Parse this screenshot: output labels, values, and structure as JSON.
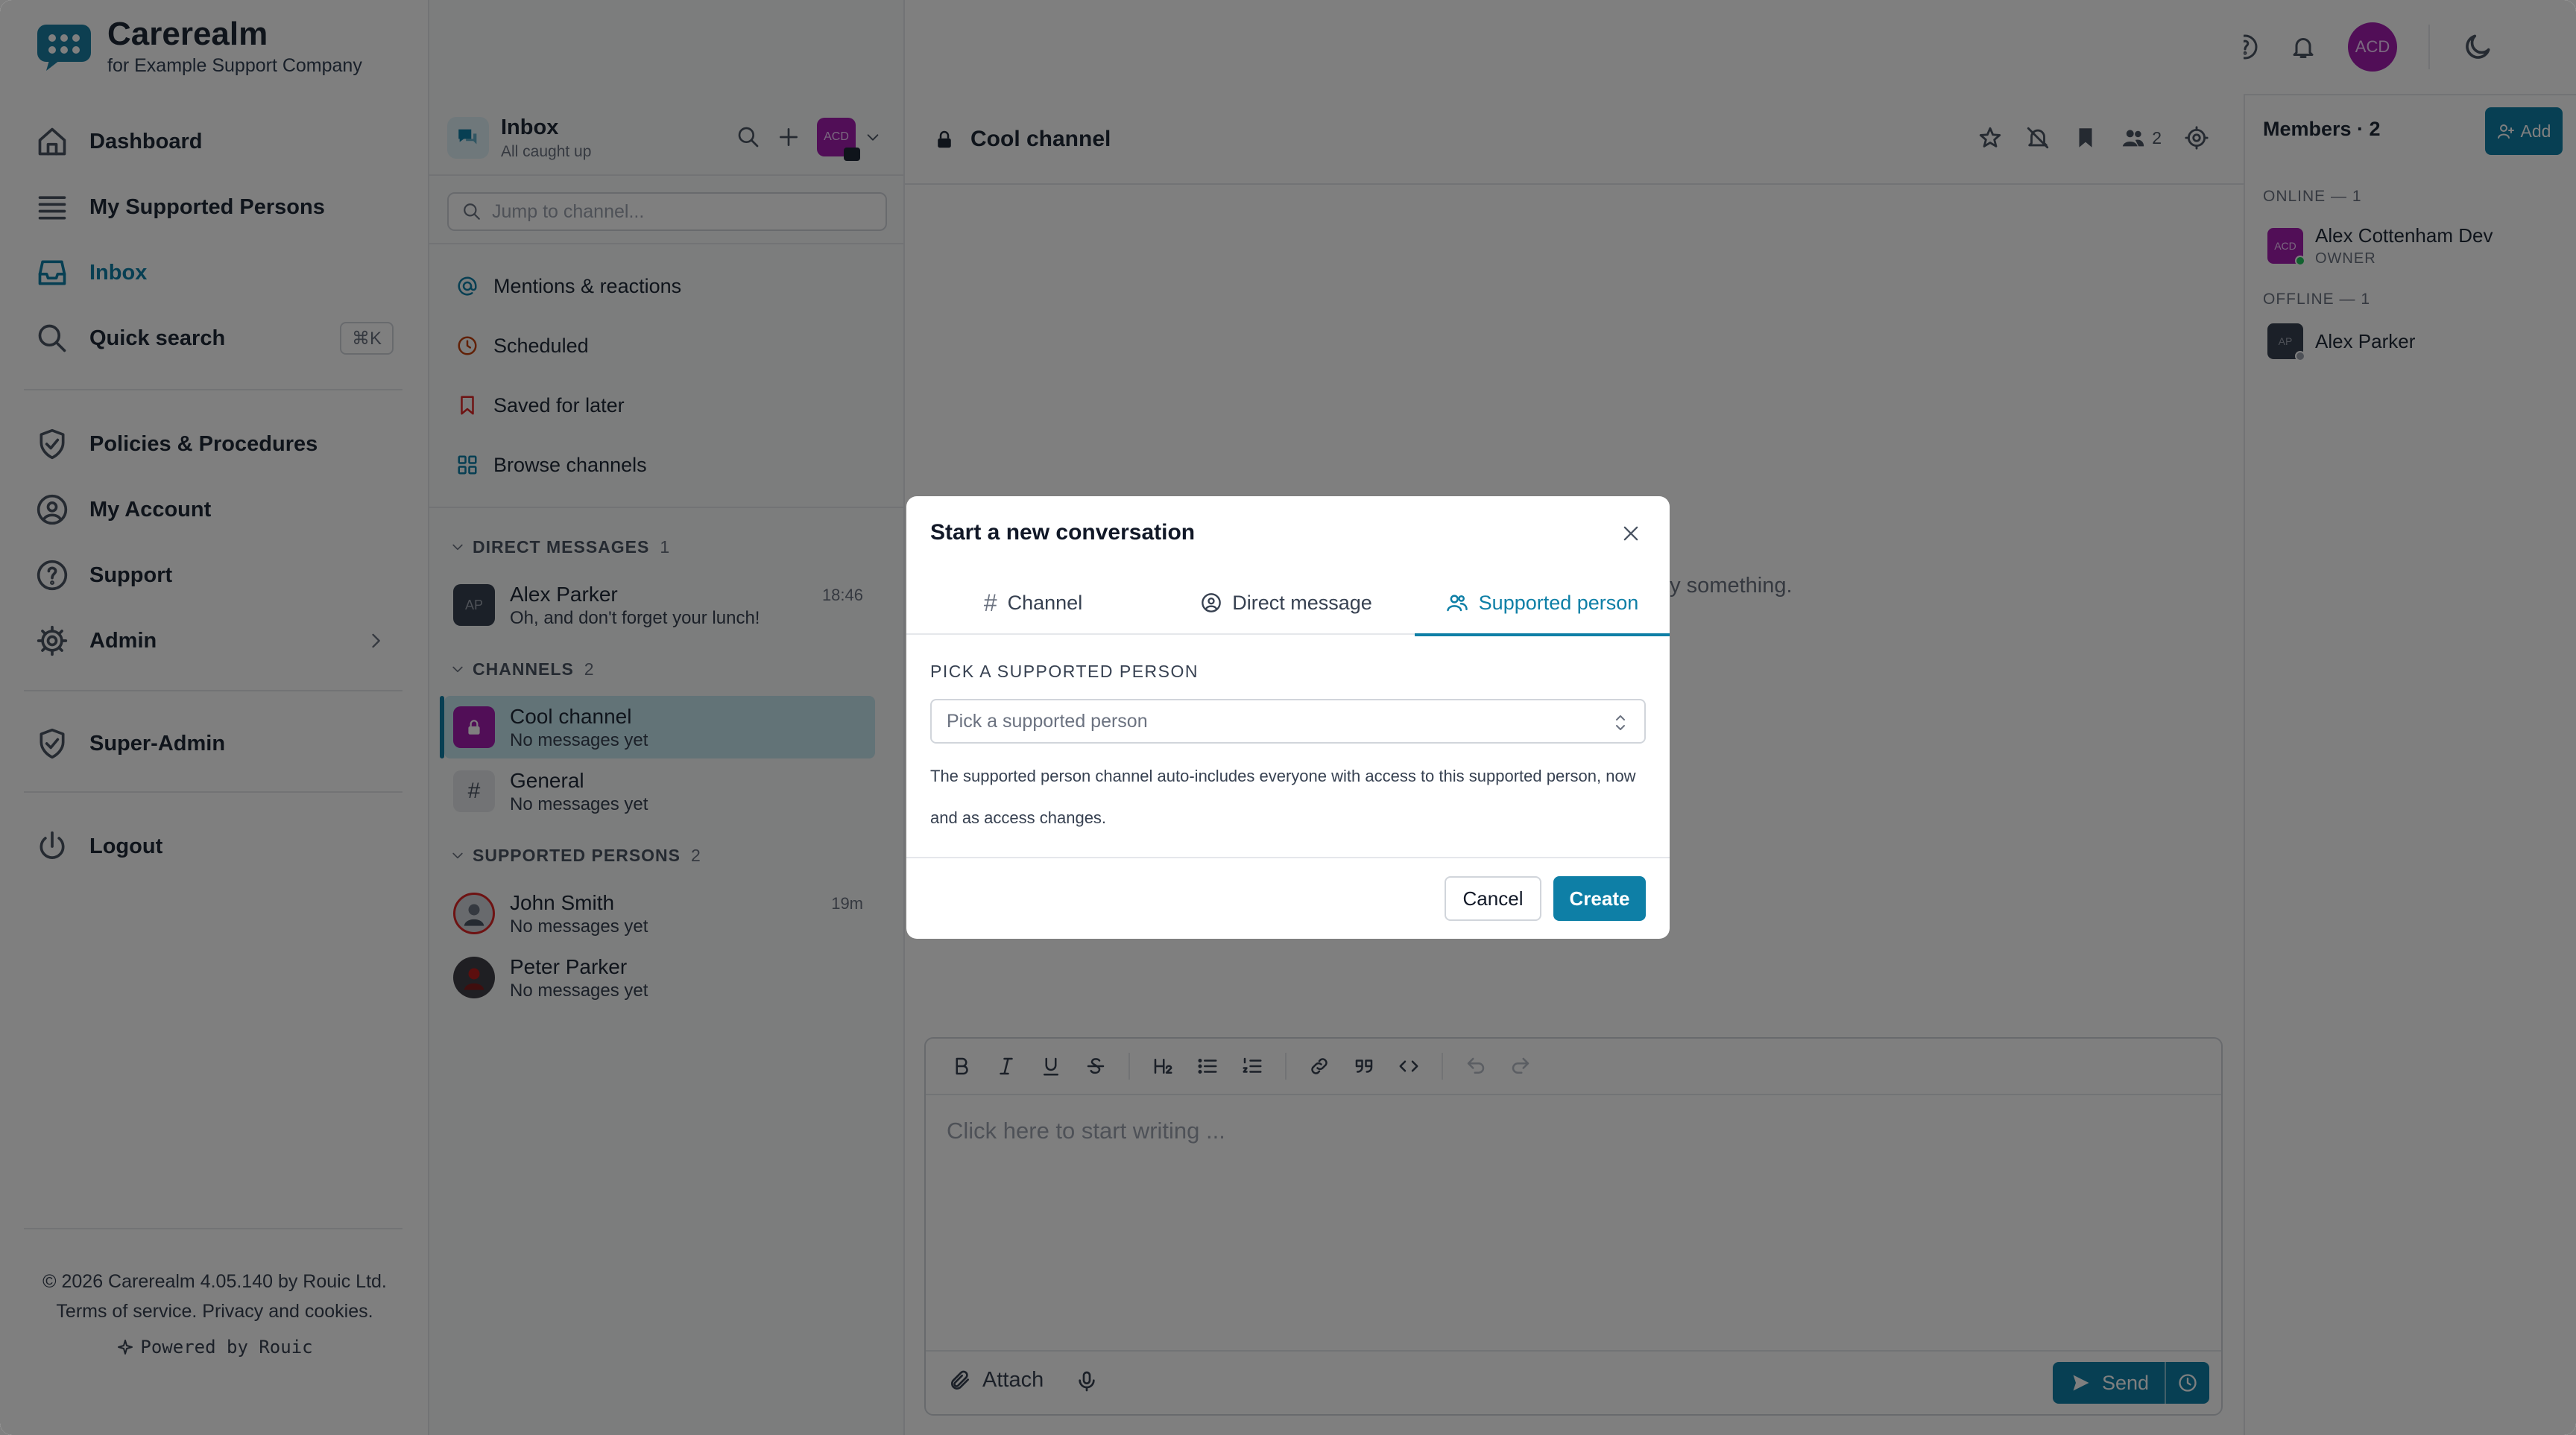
{
  "brand": {
    "name": "Carerealm",
    "sub": "for Example Support Company"
  },
  "nav": {
    "dashboard": "Dashboard",
    "supported_persons": "My Supported Persons",
    "inbox": "Inbox",
    "quick_search": "Quick search",
    "quick_search_kbd": "⌘K",
    "policies": "Policies & Procedures",
    "account": "My Account",
    "support": "Support",
    "admin": "Admin",
    "super_admin": "Super-Admin",
    "logout": "Logout"
  },
  "footer": {
    "line1": "© 2026 Carerealm 4.05.140 by Rouic Ltd.",
    "line2": "Terms of service. Privacy and cookies.",
    "powered": "Powered by Rouic"
  },
  "inbox": {
    "title": "Inbox",
    "status": "All caught up",
    "avatar_initials": "ACD",
    "jump_placeholder": "Jump to channel...",
    "links": {
      "mentions": "Mentions & reactions",
      "scheduled": "Scheduled",
      "saved": "Saved for later",
      "browse": "Browse channels"
    },
    "dm_section": {
      "label": "DIRECT MESSAGES",
      "count": "1"
    },
    "dms": [
      {
        "initials": "AP",
        "name": "Alex Parker",
        "preview": "Oh, and don't forget your lunch!",
        "time": "18:46"
      }
    ],
    "channels_section": {
      "label": "CHANNELS",
      "count": "2"
    },
    "channels": [
      {
        "name": "Cool channel",
        "preview": "No messages yet"
      },
      {
        "name": "General",
        "preview": "No messages yet"
      }
    ],
    "sp_section": {
      "label": "SUPPORTED PERSONS",
      "count": "2"
    },
    "supported": [
      {
        "name": "John Smith",
        "preview": "No messages yet",
        "time": "19m"
      },
      {
        "name": "Peter Parker",
        "preview": "No messages yet"
      }
    ]
  },
  "header": {
    "avatar_initials": "ACD"
  },
  "channel": {
    "title": "Cool channel",
    "member_count": "2",
    "empty_hint": "ay something.",
    "editor_placeholder": "Click here to start writing ...",
    "attach_label": "Attach",
    "send_label": "Send"
  },
  "members": {
    "title": "Members · 2",
    "add_label": "Add",
    "online_label": "ONLINE — 1",
    "offline_label": "OFFLINE — 1",
    "online": [
      {
        "initials": "ACD",
        "name": "Alex Cottenham Dev",
        "role": "OWNER"
      }
    ],
    "offline": [
      {
        "initials": "AP",
        "name": "Alex Parker"
      }
    ]
  },
  "modal": {
    "title": "Start a new conversation",
    "tabs": [
      {
        "label": "Channel",
        "icon": "hash-icon"
      },
      {
        "label": "Direct message",
        "icon": "user-circle-icon"
      },
      {
        "label": "Supported person",
        "icon": "users-icon"
      }
    ],
    "active_tab": "Supported person",
    "field_label": "PICK A SUPPORTED PERSON",
    "select_placeholder": "Pick a supported person",
    "help_text": "The supported person channel auto-includes everyone with access to this supported person, now and as access changes.",
    "cancel": "Cancel",
    "create": "Create"
  },
  "colors": {
    "accent": "#0e7fa6",
    "avatar_purple": "#a21caf",
    "online_green": "#22c55e"
  }
}
